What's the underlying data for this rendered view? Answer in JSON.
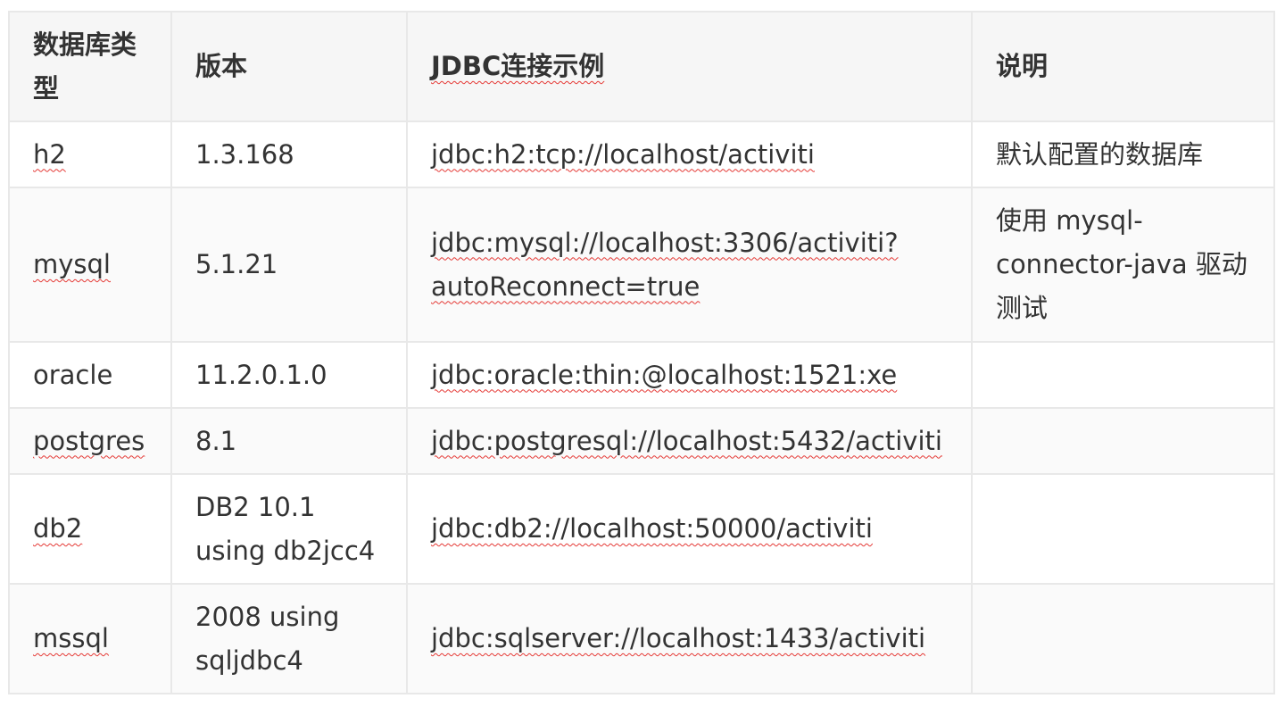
{
  "headers": {
    "type": "数据库类型",
    "version": "版本",
    "jdbc": "JDBC连接示例",
    "note": "说明"
  },
  "rows": [
    {
      "type": "h2",
      "version": "1.3.168",
      "jdbc": "jdbc:h2:tcp://localhost/activiti",
      "note": "默认配置的数据库"
    },
    {
      "type": "mysql",
      "version": "5.1.21",
      "jdbc": "jdbc:mysql://localhost:3306/activiti?autoReconnect=true",
      "note": "使用 mysql-connector-java 驱动测试"
    },
    {
      "type": "oracle",
      "version": "11.2.0.1.0",
      "jdbc": "jdbc:oracle:thin:@localhost:1521:xe",
      "note": ""
    },
    {
      "type": "postgres",
      "version": "8.1",
      "jdbc": "jdbc:postgresql://localhost:5432/activiti",
      "note": ""
    },
    {
      "type": "db2",
      "version": "DB2 10.1 using db2jcc4",
      "jdbc": "jdbc:db2://localhost:50000/activiti",
      "note": ""
    },
    {
      "type": "mssql",
      "version": "2008 using sqljdbc4",
      "jdbc": "jdbc:sqlserver://localhost:1433/activiti",
      "note": ""
    }
  ]
}
